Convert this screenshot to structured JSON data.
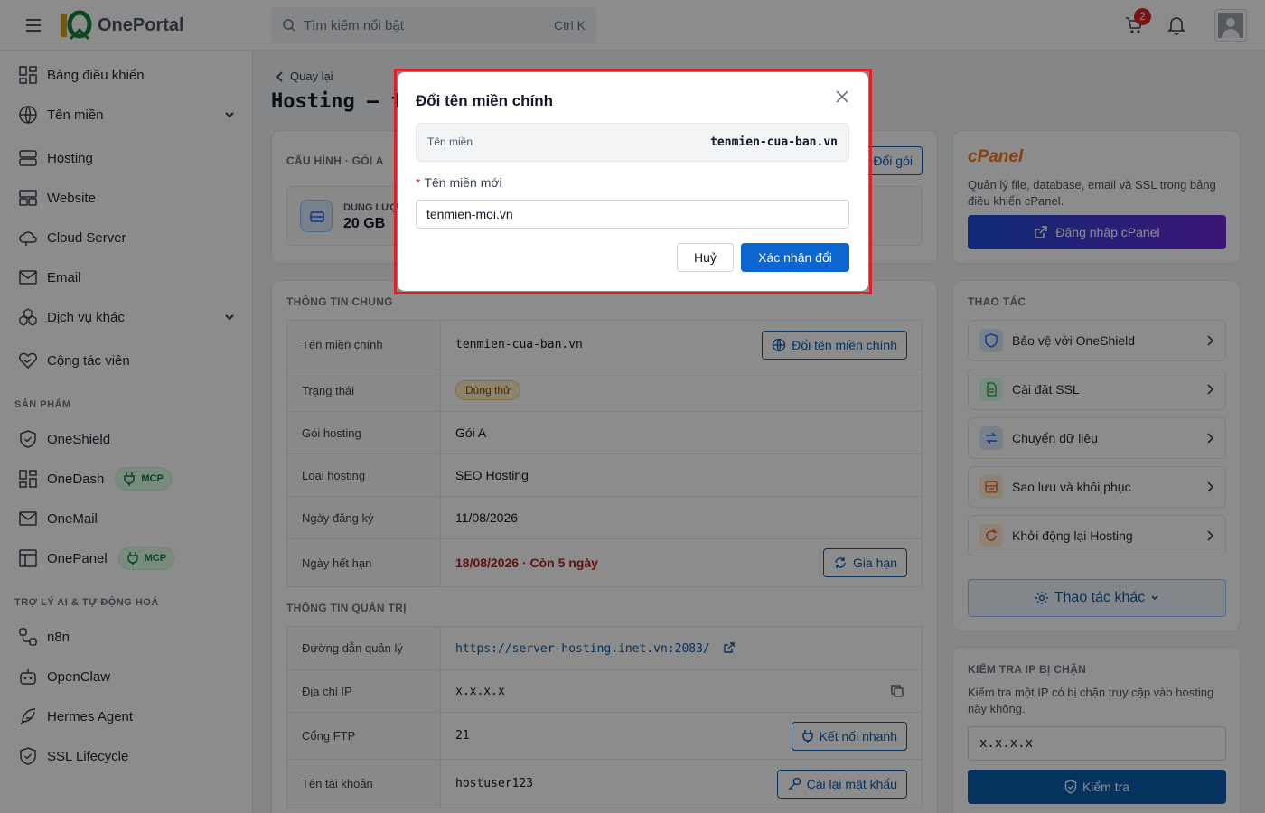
{
  "header": {
    "logo_text": "OnePortal",
    "search_placeholder": "Tìm kiếm nổi bật",
    "search_shortcut": "Ctrl K",
    "cart_count": "2"
  },
  "sidebar": {
    "items": [
      {
        "label": "Bảng điều khiển",
        "icon": "dashboard-icon"
      },
      {
        "label": "Tên miền",
        "icon": "globe-icon",
        "expandable": true
      },
      {
        "label": "Hosting",
        "icon": "server-icon"
      },
      {
        "label": "Website",
        "icon": "website-icon"
      },
      {
        "label": "Cloud Server",
        "icon": "cloud-icon"
      },
      {
        "label": "Email",
        "icon": "mail-icon"
      },
      {
        "label": "Dịch vụ khác",
        "icon": "services-icon",
        "expandable": true
      },
      {
        "label": "Cộng tác viên",
        "icon": "handshake-icon"
      }
    ],
    "products_title": "SẢN PHẨM",
    "products": [
      {
        "label": "OneShield",
        "icon": "shield-icon"
      },
      {
        "label": "OneDash",
        "icon": "dashboard-icon",
        "badge": "MCP"
      },
      {
        "label": "OneMail",
        "icon": "mail-icon"
      },
      {
        "label": "OnePanel",
        "icon": "panel-icon",
        "badge": "MCP"
      }
    ],
    "ai_title": "TRỢ LÝ AI & TỰ ĐỘNG HOÁ",
    "ai_items": [
      {
        "label": "n8n",
        "icon": "workflow-icon"
      },
      {
        "label": "OpenClaw",
        "icon": "robot-icon"
      },
      {
        "label": "Hermes Agent",
        "icon": "feather-icon"
      },
      {
        "label": "SSL Lifecycle",
        "icon": "shield-check-icon"
      }
    ]
  },
  "main": {
    "back_label": "Quay lại",
    "page_title": "Hosting — t",
    "config": {
      "title": "CẤU HÌNH · GÓI A",
      "change_plan": "Đổi gói",
      "storage_label": "DUNG LƯỢ",
      "storage_value": "20 GB"
    },
    "general": {
      "title": "THÔNG TIN CHUNG",
      "rows": [
        {
          "key": "Tên miền chính",
          "value": "tenmien-cua-ban.vn",
          "action": "Đổi tên miền chính"
        },
        {
          "key": "Trạng thái",
          "value": "Dùng thử"
        },
        {
          "key": "Gói hosting",
          "value": "Gói A"
        },
        {
          "key": "Loại hosting",
          "value": "SEO Hosting"
        },
        {
          "key": "Ngày đăng ký",
          "value": "11/08/2026"
        },
        {
          "key": "Ngày hết hạn",
          "value": "18/08/2026 · Còn 5 ngày",
          "action": "Gia hạn"
        }
      ]
    },
    "admin": {
      "title": "THÔNG TIN QUẢN TRỊ",
      "rows": [
        {
          "key": "Đường dẫn quản lý",
          "value": "https://server-hosting.inet.vn:2083/"
        },
        {
          "key": "Địa chỉ IP",
          "value": "x.x.x.x"
        },
        {
          "key": "Cổng FTP",
          "value": "21",
          "action": "Kết nối nhanh"
        },
        {
          "key": "Tên tài khoản",
          "value": "hostuser123",
          "action": "Cài lại mật khẩu"
        }
      ]
    }
  },
  "right": {
    "cpanel": {
      "title": "cPanel",
      "desc": "Quản lý file, database, email và SSL trong bảng điều khiển cPanel.",
      "login": "Đăng nhập cPanel"
    },
    "actions": {
      "title": "THAO TÁC",
      "items": [
        {
          "label": "Bảo vệ với OneShield",
          "icon": "shield-icon",
          "color": "#2563eb"
        },
        {
          "label": "Cài đặt SSL",
          "icon": "document-icon",
          "color": "#16a34a"
        },
        {
          "label": "Chuyển dữ liệu",
          "icon": "transfer-icon",
          "color": "#2563eb"
        },
        {
          "label": "Sao lưu và khôi phục",
          "icon": "backup-icon",
          "color": "#ea580c"
        },
        {
          "label": "Khởi động lại Hosting",
          "icon": "restart-icon",
          "color": "#ea580c"
        }
      ],
      "more": "Thao tác khác"
    },
    "ipcheck": {
      "title": "KIỂM TRA IP BỊ CHẶN",
      "desc": "Kiểm tra một IP có bị chặn truy cập vào hosting này không.",
      "input": "x.x.x.x",
      "button": "Kiểm tra"
    }
  },
  "modal": {
    "title": "Đổi tên miền chính",
    "current_label": "Tên miền",
    "current_value": "tenmien-cua-ban.vn",
    "new_label": "Tên miền mới",
    "required_mark": "*",
    "new_value": "tenmien-moi.vn",
    "cancel": "Huỷ",
    "confirm": "Xác nhận đổi"
  },
  "colors": {
    "primary": "#0b5cad",
    "danger": "#dc2626",
    "highlight_border": "#e11d2a",
    "badge_green": "#15803d"
  }
}
